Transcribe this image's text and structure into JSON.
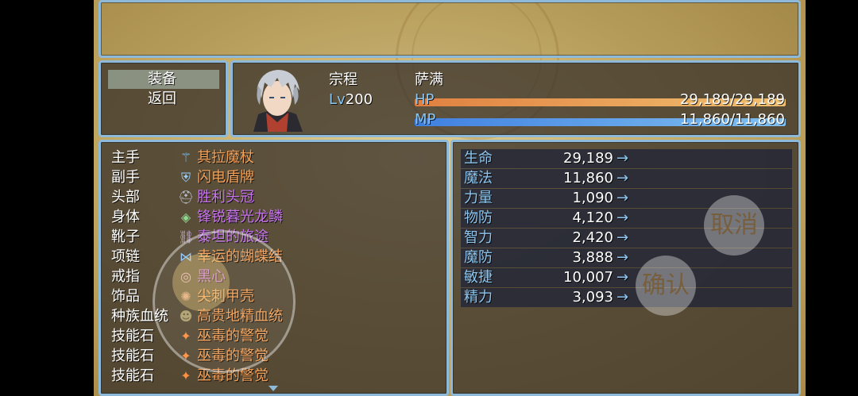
{
  "commands": [
    {
      "label": "装备",
      "selected": true
    },
    {
      "label": "返回",
      "selected": false
    }
  ],
  "actor": {
    "name": "宗程",
    "level_label": "Lv",
    "level": "200",
    "class": "萨满",
    "hp_label": "HP",
    "hp_text": "29,189/29,189",
    "hp_ratio": 1.0,
    "mp_label": "MP",
    "mp_text": "11,860/11,860",
    "mp_ratio": 1.0
  },
  "equipment": [
    {
      "slot": "主手",
      "item": "其拉魔杖",
      "icon": "staff-icon",
      "color": "#f4a25a"
    },
    {
      "slot": "副手",
      "item": "闪电盾牌",
      "icon": "shield-icon",
      "color": "#f4a25a"
    },
    {
      "slot": "头部",
      "item": "胜利头冠",
      "icon": "helmet-icon",
      "color": "#c875f0"
    },
    {
      "slot": "身体",
      "item": "锋锐暮光龙鳞",
      "icon": "armor-icon",
      "color": "#c875f0"
    },
    {
      "slot": "靴子",
      "item": "泰坦的旅途",
      "icon": "boots-icon",
      "color": "#c875f0"
    },
    {
      "slot": "项链",
      "item": "幸运的蝴蝶结",
      "icon": "bow-icon",
      "color": "#f4a25a"
    },
    {
      "slot": "戒指",
      "item": "黑心",
      "icon": "ring-icon",
      "color": "#c875f0"
    },
    {
      "slot": "饰品",
      "item": "尖刺甲壳",
      "icon": "shell-icon",
      "color": "#f4a25a"
    },
    {
      "slot": "种族血统",
      "item": "高贵地精血统",
      "icon": "goblin-icon",
      "color": "#f4a25a"
    },
    {
      "slot": "技能石",
      "item": "巫毒的警觉",
      "icon": "skill-stone-icon",
      "color": "#f4a25a"
    },
    {
      "slot": "技能石",
      "item": "巫毒的警觉",
      "icon": "skill-stone-icon",
      "color": "#f4a25a"
    },
    {
      "slot": "技能石",
      "item": "巫毒的警觉",
      "icon": "skill-stone-icon",
      "color": "#f4a25a"
    }
  ],
  "params": [
    {
      "label": "生命",
      "value": "29,189",
      "arrow": "→"
    },
    {
      "label": "魔法",
      "value": "11,860",
      "arrow": "→"
    },
    {
      "label": "力量",
      "value": "1,090",
      "arrow": "→"
    },
    {
      "label": "物防",
      "value": "4,120",
      "arrow": "→"
    },
    {
      "label": "智力",
      "value": "2,420",
      "arrow": "→"
    },
    {
      "label": "魔防",
      "value": "3,888",
      "arrow": "→"
    },
    {
      "label": "敏捷",
      "value": "10,007",
      "arrow": "→"
    },
    {
      "label": "精力",
      "value": "3,093",
      "arrow": "→"
    }
  ],
  "buttons": {
    "cancel": "取消",
    "confirm": "确认"
  },
  "colors": {
    "window_border": "#8fb9d9",
    "system_text": "#8cc6f0",
    "rare_item": "#f4a25a",
    "epic_item": "#c875f0"
  }
}
